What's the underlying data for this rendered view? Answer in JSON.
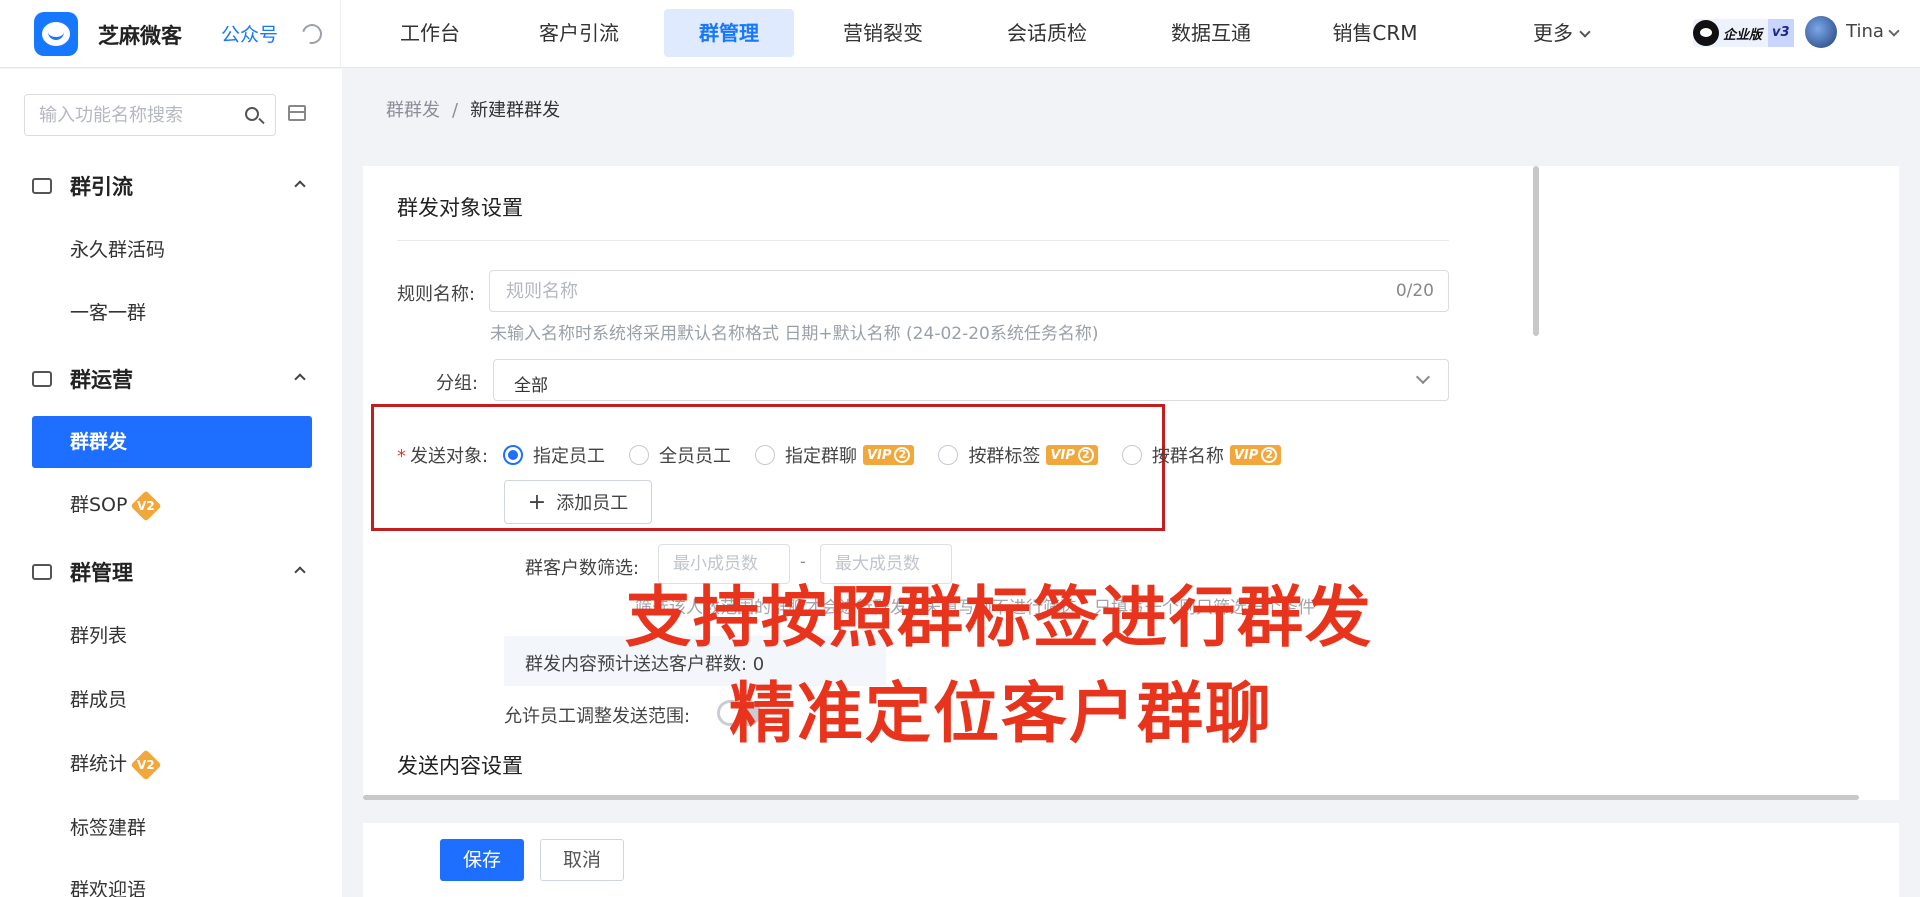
{
  "header": {
    "brand": "芝麻微客",
    "gzh": "公众号",
    "nav": [
      {
        "label": "工作台",
        "left": 0,
        "width": 120
      },
      {
        "label": "客户引流",
        "left": 0,
        "width": 130
      },
      {
        "label": "群管理",
        "left": 0,
        "width": 130
      },
      {
        "label": "营销裂变",
        "left": 0,
        "width": 160
      },
      {
        "label": "会话质检",
        "left": 0,
        "width": 160
      },
      {
        "label": "数据互通",
        "left": 0,
        "width": 160
      },
      {
        "label": "销售CRM",
        "left": 0,
        "width": 160
      },
      {
        "label": "更多",
        "left": 0,
        "width": 180
      }
    ],
    "active_nav": "群管理",
    "enterprise_label": "企业版",
    "enterprise_version": "v3",
    "user": "Tina"
  },
  "sidebar": {
    "search_placeholder": "输入功能名称搜索",
    "groups": [
      {
        "title": "群引流",
        "items": [
          "永久群活码",
          "一客一群"
        ]
      },
      {
        "title": "群运营",
        "items": [
          "群群发",
          "群SOP"
        ]
      },
      {
        "title": "群管理",
        "items": [
          "群列表",
          "群成员",
          "群统计",
          "标签建群",
          "群欢迎语"
        ]
      }
    ],
    "active_item": "群群发",
    "badge": "V2"
  },
  "breadcrumb": {
    "parent": "群群发",
    "separator": "/",
    "current": "新建群群发"
  },
  "form": {
    "section1_title": "群发对象设置",
    "rule_name_label": "规则名称:",
    "rule_name_placeholder": "规则名称",
    "rule_name_counter": "0/20",
    "rule_name_hint": "未输入名称时系统将采用默认名称格式 日期+默认名称 (24-02-20系统任务名称)",
    "group_label": "分组:",
    "group_value": "全部",
    "send_target_label": "发送对象:",
    "send_target_options": [
      "指定员工",
      "全员员工",
      "指定群聊",
      "按群标签",
      "按群名称"
    ],
    "vip_label": "VIP",
    "vip_level": "2",
    "add_employee": "添加员工",
    "member_filter_label": "群客户数筛选:",
    "min_placeholder": "最小成员数",
    "max_placeholder": "最大成员数",
    "dash": "-",
    "filter_hint": "筛选该人数范围的群聊才会进行群发，未填写则不进行筛选，只填写一个则只筛选一个条件",
    "estimate_text": "群发内容预计送达客户群数: 0",
    "allow_adjust_label": "允许员工调整发送范围:",
    "section2_title": "发送内容设置"
  },
  "overlay": {
    "line1": "支持按照群标签进行群发",
    "line2": "精准定位客户群聊"
  },
  "actions": {
    "save": "保存",
    "cancel": "取消"
  },
  "colors": {
    "primary": "#1e6fff",
    "overlay": "#e8341c",
    "highlight_border": "#c41d1d",
    "vip": "#f2a73b"
  }
}
